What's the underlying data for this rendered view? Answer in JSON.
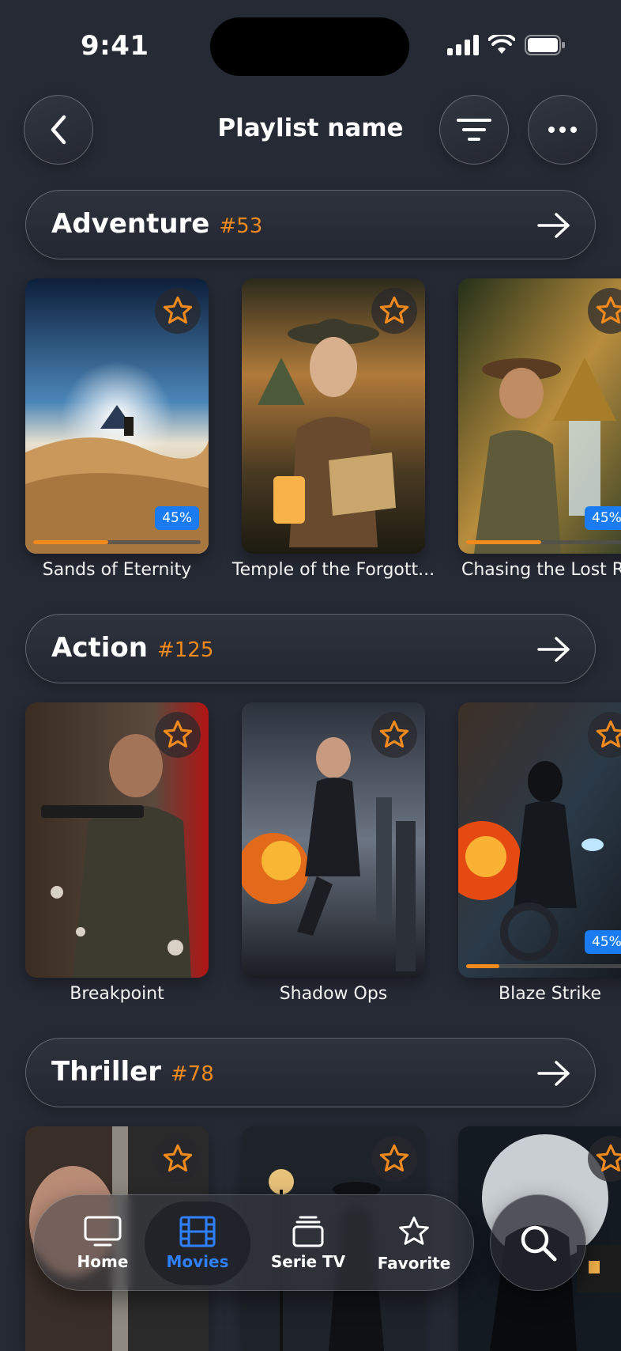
{
  "status": {
    "time": "9:41"
  },
  "header": {
    "title": "Playlist name"
  },
  "sections": [
    {
      "title": "Adventure",
      "count": "#53",
      "items": [
        {
          "title": "Sands of Eternity",
          "progress_label": "45%",
          "progress": 0.45
        },
        {
          "title": "Temple of the Forgott...",
          "progress": null
        },
        {
          "title": "Chasing the Lost Re",
          "progress_label": "45%",
          "progress": 0.45
        }
      ]
    },
    {
      "title": "Action",
      "count": "#125",
      "items": [
        {
          "title": "Breakpoint",
          "progress": null
        },
        {
          "title": "Shadow Ops",
          "progress": null
        },
        {
          "title": "Blaze Strike",
          "progress_label": "45%",
          "progress": 0.2
        }
      ]
    },
    {
      "title": "Thriller",
      "count": "#78",
      "items": [
        {
          "title": "",
          "progress": null
        },
        {
          "title": "",
          "progress": null
        },
        {
          "title": "",
          "progress": null
        }
      ]
    }
  ],
  "tabbar": {
    "tabs": [
      {
        "label": "Home",
        "icon": "tv-icon"
      },
      {
        "label": "Movies",
        "icon": "film-icon",
        "active": true
      },
      {
        "label": "Serie TV",
        "icon": "stack-icon"
      },
      {
        "label": "Favorite",
        "icon": "star-icon"
      }
    ]
  },
  "colors": {
    "accent": "#f08a1c",
    "active": "#2f80ff",
    "background": "#262a35",
    "badge": "#1a7cf0"
  }
}
